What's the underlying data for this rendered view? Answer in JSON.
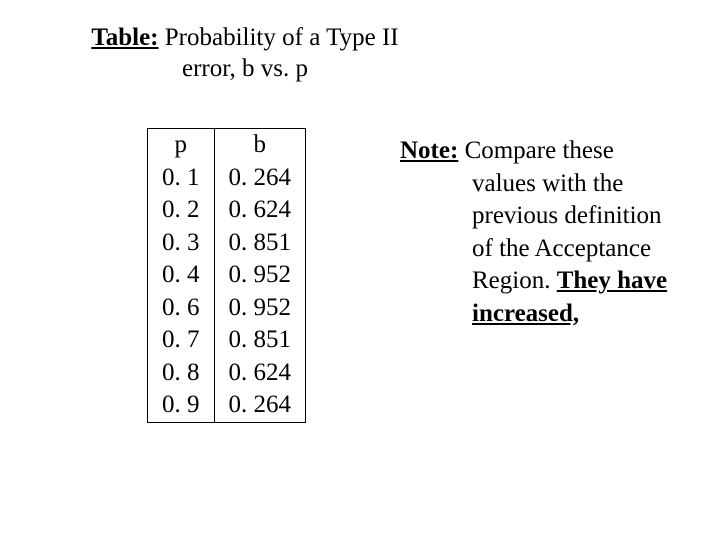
{
  "title": {
    "lead": "Table:",
    "rest_line1": " Probability of a Type II",
    "rest_line2_a": "error, ",
    "beta": "b",
    "rest_line2_b": " vs. ",
    "pi": "p"
  },
  "table": {
    "header_pi": "p",
    "header_beta": "b",
    "rows": [
      {
        "pi": "0. 1",
        "beta": "0. 264"
      },
      {
        "pi": "0. 2",
        "beta": "0. 624"
      },
      {
        "pi": "0. 3",
        "beta": "0. 851"
      },
      {
        "pi": "0. 4",
        "beta": "0. 952"
      },
      {
        "pi": "0. 6",
        "beta": "0. 952"
      },
      {
        "pi": "0. 7",
        "beta": "0. 851"
      },
      {
        "pi": "0. 8",
        "beta": "0. 624"
      },
      {
        "pi": "0. 9",
        "beta": "0. 264"
      }
    ]
  },
  "note": {
    "lead": "Note:",
    "body_a": " Compare these values with the previous definition of the Acceptance Region. ",
    "emph": "They have increased,"
  }
}
